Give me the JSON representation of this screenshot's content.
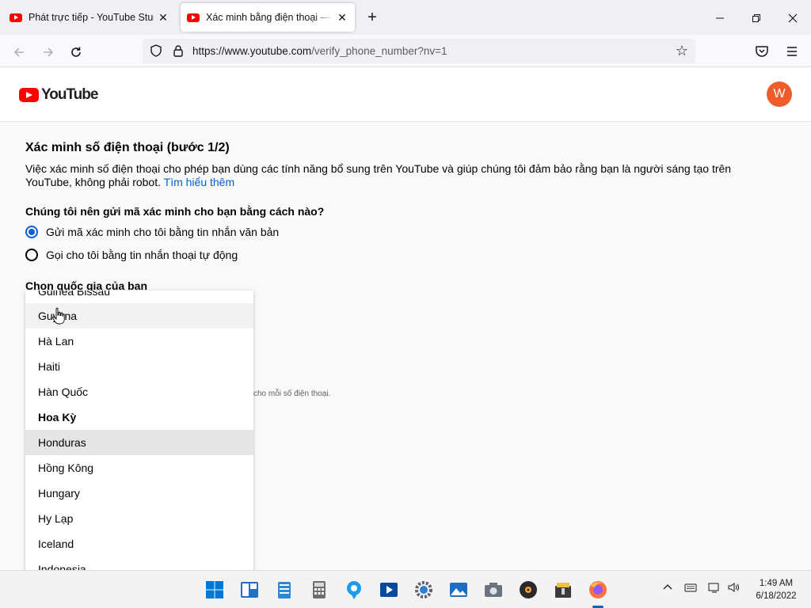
{
  "browser": {
    "tabs": [
      {
        "title": "Phát trực tiếp - YouTube Studio",
        "active": false
      },
      {
        "title": "Xác minh bằng điện thoại — YouTube",
        "active": true
      }
    ],
    "new_tab": "+",
    "url_domain": "https://www.youtube.com",
    "url_path": "/verify_phone_number?nv=1"
  },
  "header": {
    "logo_text": "YouTube",
    "avatar_letter": "W"
  },
  "main": {
    "title": "Xác minh số điện thoại (bước 1/2)",
    "description": "Việc xác minh số điện thoại cho phép bạn dùng các tính năng bổ sung trên YouTube và giúp chúng tôi đảm bảo rằng bạn là người sáng tạo trên YouTube, không phải robot.",
    "learn_more": "Tìm hiểu thêm",
    "question": "Chúng tôi nên gửi mã xác minh cho bạn bằng cách nào?",
    "options": [
      {
        "label": "Gửi mã xác minh cho tôi bằng tin nhắn văn bản",
        "checked": true
      },
      {
        "label": "Gọi cho tôi bằng tin nhắn thoại tự động",
        "checked": false
      }
    ],
    "country_label": "Chọn quốc gia của bạn",
    "note": "cho mỗi số điện thoại."
  },
  "country_dropdown": {
    "items": [
      {
        "label": "Guinea Bissau",
        "state": "normal"
      },
      {
        "label": "Guyana",
        "state": "hover"
      },
      {
        "label": "Hà Lan",
        "state": "normal"
      },
      {
        "label": "Haiti",
        "state": "normal"
      },
      {
        "label": "Hàn Quốc",
        "state": "normal"
      },
      {
        "label": "Hoa Kỳ",
        "state": "bold"
      },
      {
        "label": "Honduras",
        "state": "selected"
      },
      {
        "label": "Hồng Kông",
        "state": "normal"
      },
      {
        "label": "Hungary",
        "state": "normal"
      },
      {
        "label": "Hy Lạp",
        "state": "normal"
      },
      {
        "label": "Iceland",
        "state": "normal"
      },
      {
        "label": "Indonesia",
        "state": "normal"
      }
    ]
  },
  "taskbar": {
    "time": "1:49 AM",
    "date": "6/18/2022",
    "icons": [
      "start-icon",
      "widgets-icon",
      "notepad-icon",
      "calculator-icon",
      "maps-icon",
      "media-player-icon",
      "settings-icon",
      "photos-icon",
      "camera-icon",
      "music-icon",
      "archive-icon",
      "firefox-icon"
    ]
  },
  "colors": {
    "youtube_red": "#ff0000",
    "link_blue": "#065fd4",
    "avatar_bg": "#ef5c2a"
  }
}
